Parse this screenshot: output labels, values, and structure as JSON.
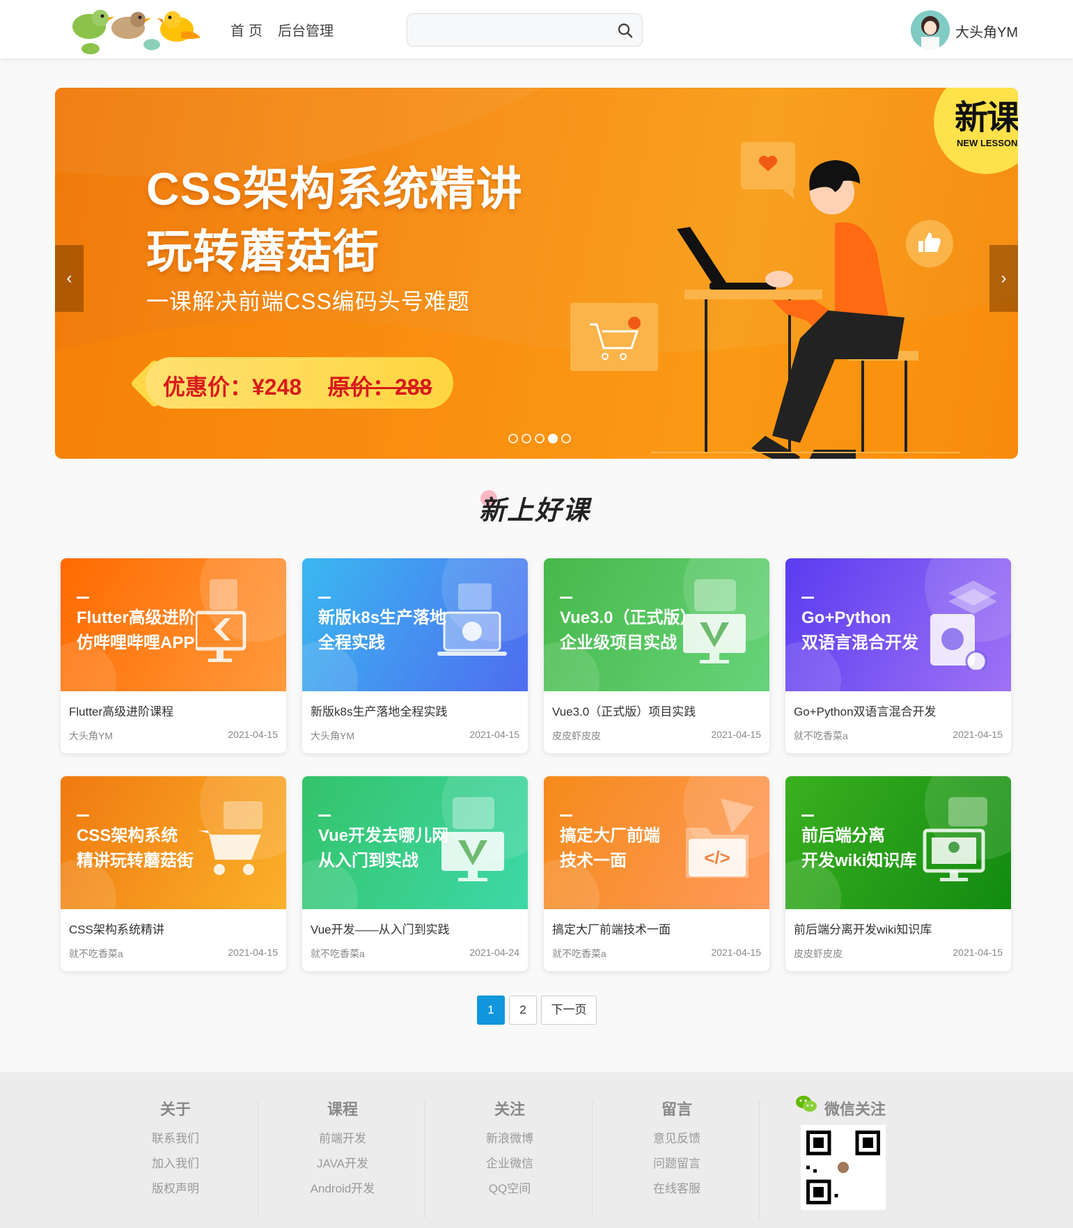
{
  "header": {
    "logo_alt": "",
    "nav": [
      {
        "label": "首页"
      },
      {
        "label": "后台管理"
      }
    ],
    "search": {
      "value": "",
      "placeholder": ""
    },
    "user": {
      "name": "大头角YM"
    }
  },
  "banner": {
    "title_line1": "CSS架构系统精讲",
    "title_line2": "玩转蘑菇街",
    "subtitle": "一课解决前端CSS编码头号难题",
    "price_now": "优惠价：¥248",
    "price_old": "原价：288",
    "badge_main": "新课",
    "badge_sub": "NEW LESSON",
    "prev_label": "‹",
    "next_label": "›",
    "slide_count": 5,
    "active_slide": 4
  },
  "section": {
    "title": "新上好课"
  },
  "courses": [
    {
      "img_text": [
        "Flutter高级进阶",
        "仿哔哩哔哩APP"
      ],
      "title": "Flutter高级进阶课程",
      "author": "大头角YM",
      "date": "2021-04-15",
      "gradient": [
        "#ff6a00",
        "#ff9a3c"
      ],
      "icon": "flutter-monitor-icon"
    },
    {
      "img_text": [
        "新版k8s生产落地",
        "全程实践"
      ],
      "title": "新版k8s生产落地全程实践",
      "author": "大头角YM",
      "date": "2021-04-15",
      "gradient": [
        "#3ab8f0",
        "#4f6cf0"
      ],
      "icon": "kubernetes-laptop-icon"
    },
    {
      "img_text": [
        "Vue3.0（正式版）",
        "企业级项目实战"
      ],
      "title": "Vue3.0（正式版）项目实践",
      "author": "皮皮虾皮皮",
      "date": "2021-04-15",
      "gradient": [
        "#47b84a",
        "#66d47a"
      ],
      "icon": "vue-monitor-icon"
    },
    {
      "img_text": [
        "Go+Python",
        "双语言混合开发"
      ],
      "title": "Go+Python双语言混合开发",
      "author": "就不吃香菜a",
      "date": "2021-04-15",
      "gradient": [
        "#5a3cf0",
        "#9f72f5"
      ],
      "icon": "python-doc-icon"
    },
    {
      "img_text": [
        "CSS架构系统",
        "精讲玩转蘑菇街"
      ],
      "title": "CSS架构系统精讲",
      "author": "就不吃香菜a",
      "date": "2021-04-15",
      "gradient": [
        "#f07a10",
        "#fbb02a"
      ],
      "icon": "shopping-cart-icon"
    },
    {
      "img_text": [
        "Vue开发去哪儿网",
        "从入门到实战"
      ],
      "title": "Vue开发——从入门到实践",
      "author": "就不吃香菜a",
      "date": "2021-04-24",
      "gradient": [
        "#34c36a",
        "#3ed8a8"
      ],
      "icon": "vue-monitor-icon"
    },
    {
      "img_text": [
        "搞定大厂前端",
        "技术一面"
      ],
      "title": "搞定大厂前端技术一面",
      "author": "就不吃香菜a",
      "date": "2021-04-15",
      "gradient": [
        "#f58a1a",
        "#ff9a5c"
      ],
      "icon": "code-folder-icon"
    },
    {
      "img_text": [
        "前后端分离",
        "开发wiki知识库"
      ],
      "title": "前后端分离开发wiki知识库",
      "author": "皮皮虾皮皮",
      "date": "2021-04-15",
      "gradient": [
        "#3ab020",
        "#128a10"
      ],
      "icon": "springboot-monitor-icon"
    }
  ],
  "pagination": {
    "pages": [
      "1",
      "2"
    ],
    "active": "1",
    "next_label": "下一页"
  },
  "footer": {
    "columns": [
      {
        "head": "关于",
        "links": [
          "联系我们",
          "加入我们",
          "版权声明"
        ]
      },
      {
        "head": "课程",
        "links": [
          "前端开发",
          "JAVA开发",
          "Android开发"
        ]
      },
      {
        "head": "关注",
        "links": [
          "新浪微博",
          "企业微信",
          "QQ空间"
        ]
      },
      {
        "head": "留言",
        "links": [
          "意见反馈",
          "问题留言",
          "在线客服"
        ]
      }
    ],
    "wechat_head": "微信关注"
  },
  "colors": {
    "accent": "#1296db",
    "banner_orange": "#f7921a",
    "price_red": "#d81b1b"
  }
}
